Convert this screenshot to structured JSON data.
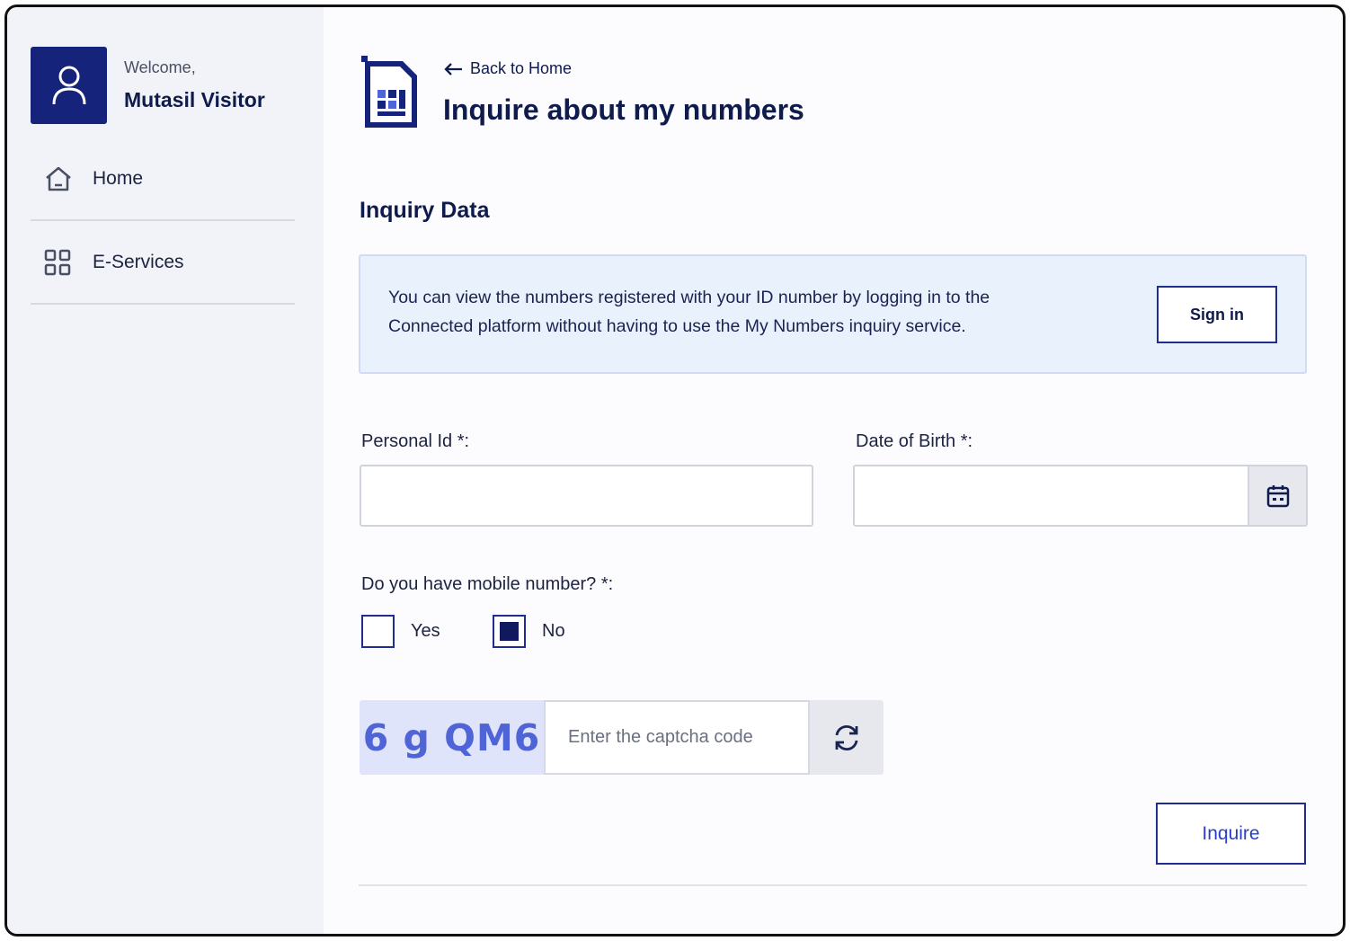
{
  "sidebar": {
    "welcome": "Welcome,",
    "user_name": "Mutasil Visitor",
    "items": [
      {
        "label": "Home",
        "icon": "home-icon"
      },
      {
        "label": "E-Services",
        "icon": "grid-icon"
      }
    ]
  },
  "header": {
    "back_label": "Back to Home",
    "title": "Inquire about my numbers"
  },
  "section": {
    "title": "Inquiry Data"
  },
  "info": {
    "text": "You can view the numbers registered with your ID number by logging in to the Connected platform without having to use the My Numbers inquiry service.",
    "sign_in_label": "Sign in"
  },
  "form": {
    "personal_id_label": "Personal Id *:",
    "personal_id_value": "",
    "dob_label": "Date of Birth *:",
    "dob_value": "",
    "mobile_question": "Do you have mobile number? *:",
    "options": [
      {
        "label": "Yes",
        "checked": false
      },
      {
        "label": "No",
        "checked": true
      }
    ]
  },
  "captcha": {
    "code": "6 g QM6",
    "placeholder": "Enter the captcha code"
  },
  "actions": {
    "inquire_label": "Inquire"
  },
  "colors": {
    "primary_navy": "#15237a",
    "info_bg": "#e9f1fd",
    "captcha_text": "#4f64d6"
  }
}
